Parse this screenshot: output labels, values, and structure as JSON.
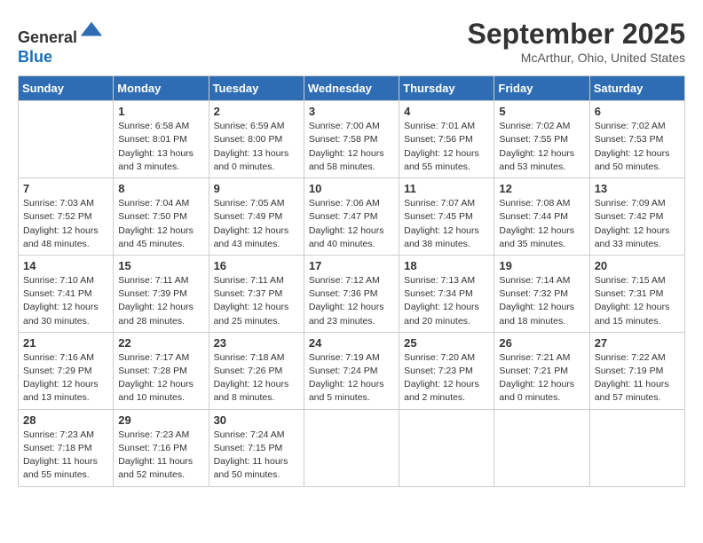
{
  "header": {
    "logo_line1": "General",
    "logo_line2": "Blue",
    "month_title": "September 2025",
    "location": "McArthur, Ohio, United States"
  },
  "weekdays": [
    "Sunday",
    "Monday",
    "Tuesday",
    "Wednesday",
    "Thursday",
    "Friday",
    "Saturday"
  ],
  "weeks": [
    [
      {
        "day": "",
        "info": ""
      },
      {
        "day": "1",
        "info": "Sunrise: 6:58 AM\nSunset: 8:01 PM\nDaylight: 13 hours\nand 3 minutes."
      },
      {
        "day": "2",
        "info": "Sunrise: 6:59 AM\nSunset: 8:00 PM\nDaylight: 13 hours\nand 0 minutes."
      },
      {
        "day": "3",
        "info": "Sunrise: 7:00 AM\nSunset: 7:58 PM\nDaylight: 12 hours\nand 58 minutes."
      },
      {
        "day": "4",
        "info": "Sunrise: 7:01 AM\nSunset: 7:56 PM\nDaylight: 12 hours\nand 55 minutes."
      },
      {
        "day": "5",
        "info": "Sunrise: 7:02 AM\nSunset: 7:55 PM\nDaylight: 12 hours\nand 53 minutes."
      },
      {
        "day": "6",
        "info": "Sunrise: 7:02 AM\nSunset: 7:53 PM\nDaylight: 12 hours\nand 50 minutes."
      }
    ],
    [
      {
        "day": "7",
        "info": "Sunrise: 7:03 AM\nSunset: 7:52 PM\nDaylight: 12 hours\nand 48 minutes."
      },
      {
        "day": "8",
        "info": "Sunrise: 7:04 AM\nSunset: 7:50 PM\nDaylight: 12 hours\nand 45 minutes."
      },
      {
        "day": "9",
        "info": "Sunrise: 7:05 AM\nSunset: 7:49 PM\nDaylight: 12 hours\nand 43 minutes."
      },
      {
        "day": "10",
        "info": "Sunrise: 7:06 AM\nSunset: 7:47 PM\nDaylight: 12 hours\nand 40 minutes."
      },
      {
        "day": "11",
        "info": "Sunrise: 7:07 AM\nSunset: 7:45 PM\nDaylight: 12 hours\nand 38 minutes."
      },
      {
        "day": "12",
        "info": "Sunrise: 7:08 AM\nSunset: 7:44 PM\nDaylight: 12 hours\nand 35 minutes."
      },
      {
        "day": "13",
        "info": "Sunrise: 7:09 AM\nSunset: 7:42 PM\nDaylight: 12 hours\nand 33 minutes."
      }
    ],
    [
      {
        "day": "14",
        "info": "Sunrise: 7:10 AM\nSunset: 7:41 PM\nDaylight: 12 hours\nand 30 minutes."
      },
      {
        "day": "15",
        "info": "Sunrise: 7:11 AM\nSunset: 7:39 PM\nDaylight: 12 hours\nand 28 minutes."
      },
      {
        "day": "16",
        "info": "Sunrise: 7:11 AM\nSunset: 7:37 PM\nDaylight: 12 hours\nand 25 minutes."
      },
      {
        "day": "17",
        "info": "Sunrise: 7:12 AM\nSunset: 7:36 PM\nDaylight: 12 hours\nand 23 minutes."
      },
      {
        "day": "18",
        "info": "Sunrise: 7:13 AM\nSunset: 7:34 PM\nDaylight: 12 hours\nand 20 minutes."
      },
      {
        "day": "19",
        "info": "Sunrise: 7:14 AM\nSunset: 7:32 PM\nDaylight: 12 hours\nand 18 minutes."
      },
      {
        "day": "20",
        "info": "Sunrise: 7:15 AM\nSunset: 7:31 PM\nDaylight: 12 hours\nand 15 minutes."
      }
    ],
    [
      {
        "day": "21",
        "info": "Sunrise: 7:16 AM\nSunset: 7:29 PM\nDaylight: 12 hours\nand 13 minutes."
      },
      {
        "day": "22",
        "info": "Sunrise: 7:17 AM\nSunset: 7:28 PM\nDaylight: 12 hours\nand 10 minutes."
      },
      {
        "day": "23",
        "info": "Sunrise: 7:18 AM\nSunset: 7:26 PM\nDaylight: 12 hours\nand 8 minutes."
      },
      {
        "day": "24",
        "info": "Sunrise: 7:19 AM\nSunset: 7:24 PM\nDaylight: 12 hours\nand 5 minutes."
      },
      {
        "day": "25",
        "info": "Sunrise: 7:20 AM\nSunset: 7:23 PM\nDaylight: 12 hours\nand 2 minutes."
      },
      {
        "day": "26",
        "info": "Sunrise: 7:21 AM\nSunset: 7:21 PM\nDaylight: 12 hours\nand 0 minutes."
      },
      {
        "day": "27",
        "info": "Sunrise: 7:22 AM\nSunset: 7:19 PM\nDaylight: 11 hours\nand 57 minutes."
      }
    ],
    [
      {
        "day": "28",
        "info": "Sunrise: 7:23 AM\nSunset: 7:18 PM\nDaylight: 11 hours\nand 55 minutes."
      },
      {
        "day": "29",
        "info": "Sunrise: 7:23 AM\nSunset: 7:16 PM\nDaylight: 11 hours\nand 52 minutes."
      },
      {
        "day": "30",
        "info": "Sunrise: 7:24 AM\nSunset: 7:15 PM\nDaylight: 11 hours\nand 50 minutes."
      },
      {
        "day": "",
        "info": ""
      },
      {
        "day": "",
        "info": ""
      },
      {
        "day": "",
        "info": ""
      },
      {
        "day": "",
        "info": ""
      }
    ]
  ]
}
